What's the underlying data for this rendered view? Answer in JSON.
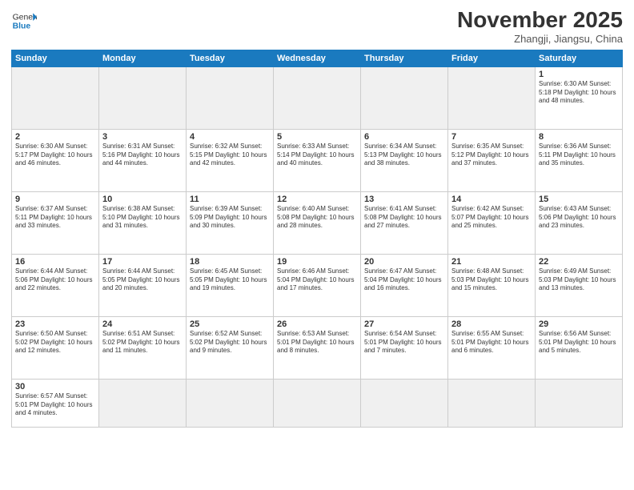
{
  "header": {
    "logo_general": "General",
    "logo_blue": "Blue",
    "month_title": "November 2025",
    "subtitle": "Zhangji, Jiangsu, China"
  },
  "days_of_week": [
    "Sunday",
    "Monday",
    "Tuesday",
    "Wednesday",
    "Thursday",
    "Friday",
    "Saturday"
  ],
  "weeks": [
    [
      {
        "num": "",
        "info": ""
      },
      {
        "num": "",
        "info": ""
      },
      {
        "num": "",
        "info": ""
      },
      {
        "num": "",
        "info": ""
      },
      {
        "num": "",
        "info": ""
      },
      {
        "num": "",
        "info": ""
      },
      {
        "num": "1",
        "info": "Sunrise: 6:30 AM\nSunset: 5:18 PM\nDaylight: 10 hours\nand 48 minutes."
      }
    ],
    [
      {
        "num": "2",
        "info": "Sunrise: 6:30 AM\nSunset: 5:17 PM\nDaylight: 10 hours\nand 46 minutes."
      },
      {
        "num": "3",
        "info": "Sunrise: 6:31 AM\nSunset: 5:16 PM\nDaylight: 10 hours\nand 44 minutes."
      },
      {
        "num": "4",
        "info": "Sunrise: 6:32 AM\nSunset: 5:15 PM\nDaylight: 10 hours\nand 42 minutes."
      },
      {
        "num": "5",
        "info": "Sunrise: 6:33 AM\nSunset: 5:14 PM\nDaylight: 10 hours\nand 40 minutes."
      },
      {
        "num": "6",
        "info": "Sunrise: 6:34 AM\nSunset: 5:13 PM\nDaylight: 10 hours\nand 38 minutes."
      },
      {
        "num": "7",
        "info": "Sunrise: 6:35 AM\nSunset: 5:12 PM\nDaylight: 10 hours\nand 37 minutes."
      },
      {
        "num": "8",
        "info": "Sunrise: 6:36 AM\nSunset: 5:11 PM\nDaylight: 10 hours\nand 35 minutes."
      }
    ],
    [
      {
        "num": "9",
        "info": "Sunrise: 6:37 AM\nSunset: 5:11 PM\nDaylight: 10 hours\nand 33 minutes."
      },
      {
        "num": "10",
        "info": "Sunrise: 6:38 AM\nSunset: 5:10 PM\nDaylight: 10 hours\nand 31 minutes."
      },
      {
        "num": "11",
        "info": "Sunrise: 6:39 AM\nSunset: 5:09 PM\nDaylight: 10 hours\nand 30 minutes."
      },
      {
        "num": "12",
        "info": "Sunrise: 6:40 AM\nSunset: 5:08 PM\nDaylight: 10 hours\nand 28 minutes."
      },
      {
        "num": "13",
        "info": "Sunrise: 6:41 AM\nSunset: 5:08 PM\nDaylight: 10 hours\nand 27 minutes."
      },
      {
        "num": "14",
        "info": "Sunrise: 6:42 AM\nSunset: 5:07 PM\nDaylight: 10 hours\nand 25 minutes."
      },
      {
        "num": "15",
        "info": "Sunrise: 6:43 AM\nSunset: 5:06 PM\nDaylight: 10 hours\nand 23 minutes."
      }
    ],
    [
      {
        "num": "16",
        "info": "Sunrise: 6:44 AM\nSunset: 5:06 PM\nDaylight: 10 hours\nand 22 minutes."
      },
      {
        "num": "17",
        "info": "Sunrise: 6:44 AM\nSunset: 5:05 PM\nDaylight: 10 hours\nand 20 minutes."
      },
      {
        "num": "18",
        "info": "Sunrise: 6:45 AM\nSunset: 5:05 PM\nDaylight: 10 hours\nand 19 minutes."
      },
      {
        "num": "19",
        "info": "Sunrise: 6:46 AM\nSunset: 5:04 PM\nDaylight: 10 hours\nand 17 minutes."
      },
      {
        "num": "20",
        "info": "Sunrise: 6:47 AM\nSunset: 5:04 PM\nDaylight: 10 hours\nand 16 minutes."
      },
      {
        "num": "21",
        "info": "Sunrise: 6:48 AM\nSunset: 5:03 PM\nDaylight: 10 hours\nand 15 minutes."
      },
      {
        "num": "22",
        "info": "Sunrise: 6:49 AM\nSunset: 5:03 PM\nDaylight: 10 hours\nand 13 minutes."
      }
    ],
    [
      {
        "num": "23",
        "info": "Sunrise: 6:50 AM\nSunset: 5:02 PM\nDaylight: 10 hours\nand 12 minutes."
      },
      {
        "num": "24",
        "info": "Sunrise: 6:51 AM\nSunset: 5:02 PM\nDaylight: 10 hours\nand 11 minutes."
      },
      {
        "num": "25",
        "info": "Sunrise: 6:52 AM\nSunset: 5:02 PM\nDaylight: 10 hours\nand 9 minutes."
      },
      {
        "num": "26",
        "info": "Sunrise: 6:53 AM\nSunset: 5:01 PM\nDaylight: 10 hours\nand 8 minutes."
      },
      {
        "num": "27",
        "info": "Sunrise: 6:54 AM\nSunset: 5:01 PM\nDaylight: 10 hours\nand 7 minutes."
      },
      {
        "num": "28",
        "info": "Sunrise: 6:55 AM\nSunset: 5:01 PM\nDaylight: 10 hours\nand 6 minutes."
      },
      {
        "num": "29",
        "info": "Sunrise: 6:56 AM\nSunset: 5:01 PM\nDaylight: 10 hours\nand 5 minutes."
      }
    ],
    [
      {
        "num": "30",
        "info": "Sunrise: 6:57 AM\nSunset: 5:01 PM\nDaylight: 10 hours\nand 4 minutes."
      },
      {
        "num": "",
        "info": ""
      },
      {
        "num": "",
        "info": ""
      },
      {
        "num": "",
        "info": ""
      },
      {
        "num": "",
        "info": ""
      },
      {
        "num": "",
        "info": ""
      },
      {
        "num": "",
        "info": ""
      }
    ]
  ]
}
